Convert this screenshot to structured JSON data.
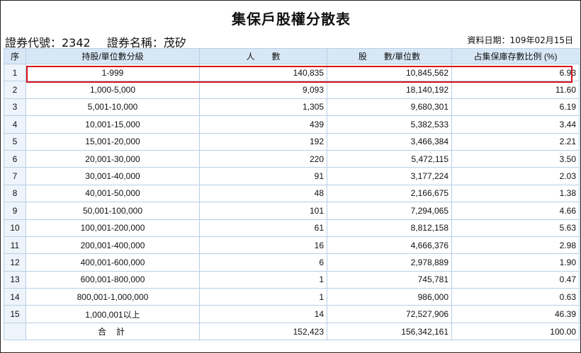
{
  "title": "集保戶股權分散表",
  "security": {
    "code_label": "證券代號：2342",
    "name_label": "證券名稱：茂矽"
  },
  "data_date": "資料日期：109年02月15日",
  "headers": {
    "seq": "序",
    "range": "持股/單位數分級",
    "people": "人　　數",
    "shares": "股　　數/單位數",
    "pct": "占集保庫存數比例 (%)"
  },
  "rows": [
    {
      "seq": "1",
      "range": "1-999",
      "people": "140,835",
      "shares": "10,845,562",
      "pct": "6.93"
    },
    {
      "seq": "2",
      "range": "1,000-5,000",
      "people": "9,093",
      "shares": "18,140,192",
      "pct": "11.60"
    },
    {
      "seq": "3",
      "range": "5,001-10,000",
      "people": "1,305",
      "shares": "9,680,301",
      "pct": "6.19"
    },
    {
      "seq": "4",
      "range": "10,001-15,000",
      "people": "439",
      "shares": "5,382,533",
      "pct": "3.44"
    },
    {
      "seq": "5",
      "range": "15,001-20,000",
      "people": "192",
      "shares": "3,466,384",
      "pct": "2.21"
    },
    {
      "seq": "6",
      "range": "20,001-30,000",
      "people": "220",
      "shares": "5,472,115",
      "pct": "3.50"
    },
    {
      "seq": "7",
      "range": "30,001-40,000",
      "people": "91",
      "shares": "3,177,224",
      "pct": "2.03"
    },
    {
      "seq": "8",
      "range": "40,001-50,000",
      "people": "48",
      "shares": "2,166,675",
      "pct": "1.38"
    },
    {
      "seq": "9",
      "range": "50,001-100,000",
      "people": "101",
      "shares": "7,294,065",
      "pct": "4.66"
    },
    {
      "seq": "10",
      "range": "100,001-200,000",
      "people": "61",
      "shares": "8,812,158",
      "pct": "5.63"
    },
    {
      "seq": "11",
      "range": "200,001-400,000",
      "people": "16",
      "shares": "4,666,376",
      "pct": "2.98"
    },
    {
      "seq": "12",
      "range": "400,001-600,000",
      "people": "6",
      "shares": "2,978,889",
      "pct": "1.90"
    },
    {
      "seq": "13",
      "range": "600,001-800,000",
      "people": "1",
      "shares": "745,781",
      "pct": "0.47"
    },
    {
      "seq": "14",
      "range": "800,001-1,000,000",
      "people": "1",
      "shares": "986,000",
      "pct": "0.63"
    },
    {
      "seq": "15",
      "range": "1,000,001以上",
      "people": "14",
      "shares": "72,527,906",
      "pct": "46.39"
    }
  ],
  "total": {
    "label": "合計",
    "people": "152,423",
    "shares": "156,342,161",
    "pct": "100.00"
  },
  "highlight_color": "#d8111b"
}
